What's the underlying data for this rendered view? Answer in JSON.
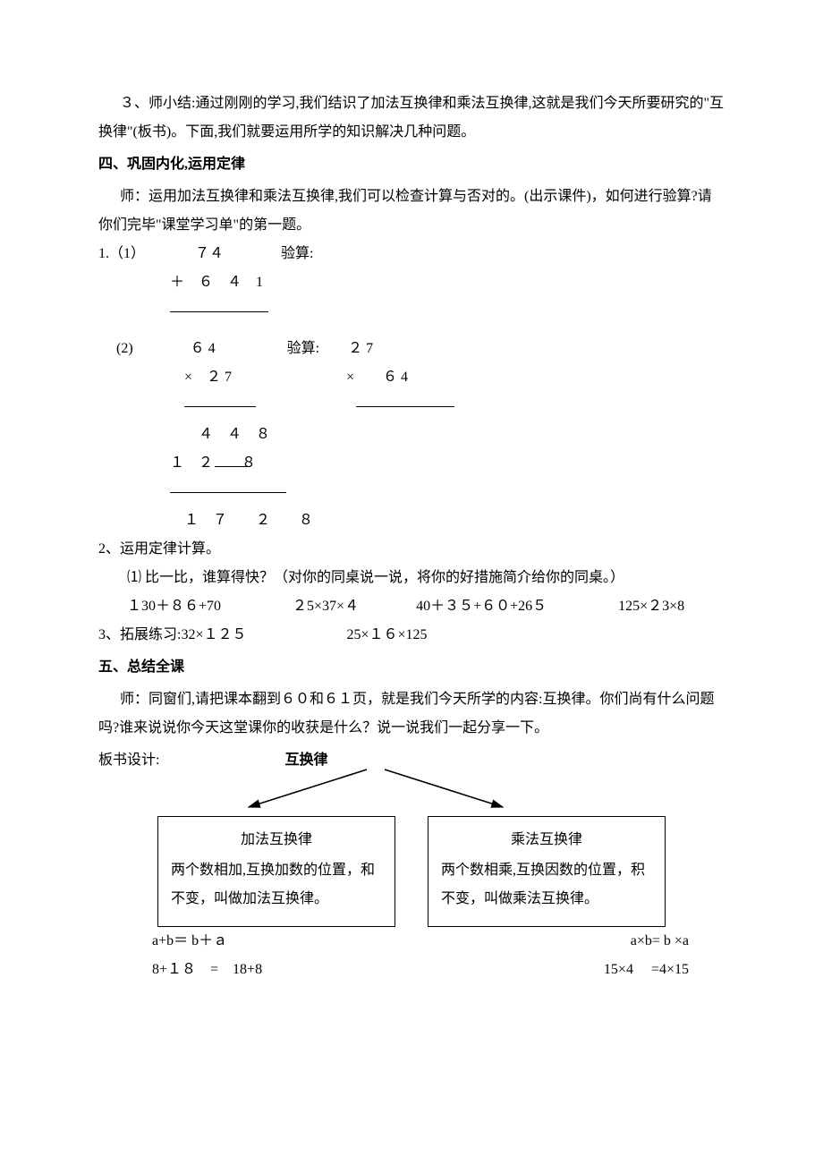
{
  "p1": "３、师小结:通过刚刚的学习,我们结识了加法互换律和乘法互换律,这就是我们今天所要研究的\"互换律\"(板书)。下面,我们就要运用所学的知识解决几种问题。",
  "h4": "四、巩固内化,运用定律",
  "p2": "师：运用加法互换律和乘法互换律,我们可以检查计算与否对的。(出示课件)，如何进行验算?请你们完毕\"课堂学习单\"的第一题。",
  "calc1_l1": "1.（1）　　　　７４　　　　验算:",
  "calc1_l2": "　　　　　＋　６　４　1",
  "calc2_l1": "　 (2)　　　　６ 4　　　　　验算:　　２ 7",
  "calc2_l2": "　　　　　　×　２ 7　　　　　　　　×　　６ 4",
  "calc2_l3": "　　　　　　　４　４　８",
  "calc2_l4": "　　　　　１　２　　８",
  "calc2_l5": "　　　　　　１　７　　２　　８",
  "p3": "2、运用定律计算。",
  "p4": "⑴ 比一比，谁算得快？（对你的同桌说一说，将你的好措施简介给你的同桌。）",
  "p5": "１30＋８６+70　　　　　２5×37×４　　　　40＋３５+６０+26５　　　　　125×２3×8",
  "p6": " 3、拓展练习:32×１２５　　　　　　　25×１６×125",
  "h5": "五、总结全课",
  "p7": "师：同窗们,请把课本翻到６０和６１页，就是我们今天所学的内容:互换律。你们尚有什么问题吗?谁来说说你今天这堂课你的收获是什么？说一说我们一起分享一下。",
  "p8_prefix": "板书设计:",
  "board_title": "互换律",
  "box_left_title": "加法互换律",
  "box_left_body": "两个数相加,互换加数的位置，和不变，叫做加法互换律。",
  "box_right_title": "乘法互换律",
  "box_right_body": "两个数相乘,互换因数的位置，积不变，叫做乘法互换律。",
  "f1l": "a+b＝ b＋ａ",
  "f1r": "a×b= b ×a",
  "f2l": "8+１８　=　18+8",
  "f2r": "15×4 　=4×15"
}
